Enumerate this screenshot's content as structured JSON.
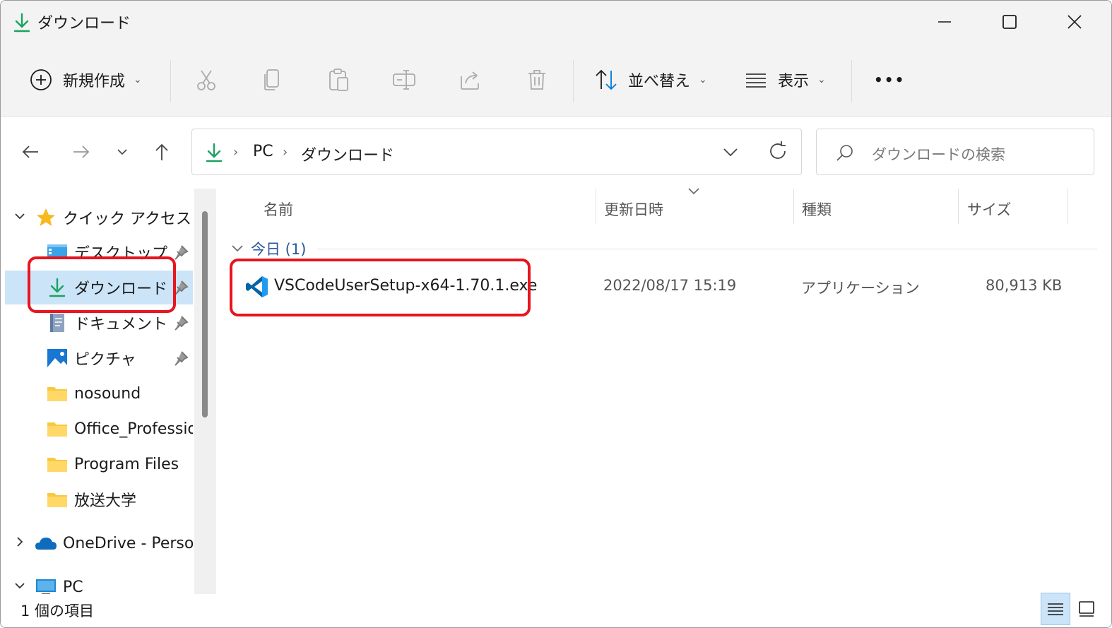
{
  "window": {
    "title": "ダウンロード"
  },
  "toolbar": {
    "new_label": "新規作成",
    "sort_label": "並べ替え",
    "view_label": "表示",
    "more_label": "•••"
  },
  "address": {
    "crumbs": [
      "PC",
      "ダウンロード"
    ],
    "search_placeholder": "ダウンロードの検索"
  },
  "sidebar": {
    "items": [
      {
        "label": "クイック アクセス",
        "icon": "star-icon"
      },
      {
        "label": "デスクトップ",
        "icon": "desktop-icon",
        "pinned": true
      },
      {
        "label": "ダウンロード",
        "icon": "download-icon",
        "pinned": true,
        "selected": true
      },
      {
        "label": "ドキュメント",
        "icon": "document-icon",
        "pinned": true
      },
      {
        "label": "ピクチャ",
        "icon": "pictures-icon",
        "pinned": true
      },
      {
        "label": "nosound",
        "icon": "folder-icon"
      },
      {
        "label": "Office_Professior",
        "icon": "folder-icon"
      },
      {
        "label": "Program Files",
        "icon": "folder-icon"
      },
      {
        "label": "放送大学",
        "icon": "folder-icon"
      },
      {
        "label": "OneDrive - Persor",
        "icon": "onedrive-icon"
      },
      {
        "label": "PC",
        "icon": "pc-icon"
      }
    ]
  },
  "columns": {
    "name": "名前",
    "date": "更新日時",
    "type": "種類",
    "size": "サイズ"
  },
  "group": {
    "label": "今日 (1)"
  },
  "files": [
    {
      "name": "VSCodeUserSetup-x64-1.70.1.exe",
      "date": "2022/08/17 15:19",
      "type": "アプリケーション",
      "size": "80,913 KB",
      "icon": "vscode-icon"
    }
  ],
  "status": {
    "count": "1 個の項目"
  },
  "colors": {
    "accent": "#0078d4",
    "highlight": "#e8141f",
    "selection": "#cce4f7",
    "download_green": "#1aa260",
    "folder": "#f8c93e"
  }
}
